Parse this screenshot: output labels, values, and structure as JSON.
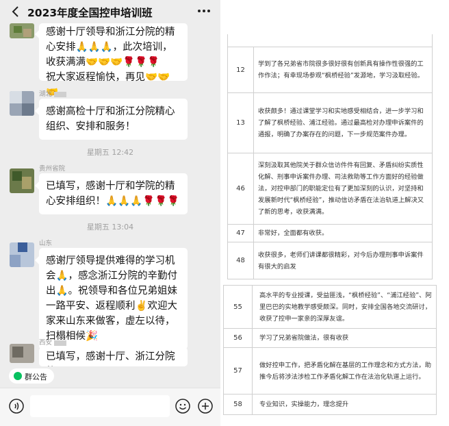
{
  "chat": {
    "title": "2023年度全国控申培训班",
    "input_placeholder": "",
    "notice_label": "群公告",
    "messages": [
      {
        "sender": "",
        "text": "感谢十厅领导和浙江分院的精心安排🙏🙏🙏，此次培训，收获满满🤝🤝🤝🌹🌹🌹\n祝大家返程愉快，再见🤝🤝🤝"
      },
      {
        "sender": "湖北",
        "text": "感谢高检十厅和浙江分院精心组织、安排和服务！"
      },
      {
        "sender": "贵州省院",
        "text": "已填写，感谢十厅和学院的精心安排组织！🙏🙏🙏🌹🌹🌹"
      },
      {
        "sender": "山东",
        "text": "感谢厅领导提供难得的学习机会🙏，感念浙江分院的辛勤付出🙏。祝领导和各位兄弟姐妹一路平安、返程顺利✌️欢迎大家来山东来做客，虚左以待，扫榻相候🎉"
      },
      {
        "sender": "西安",
        "text": "已填写，感谢十厅、浙江分院的"
      }
    ],
    "timestamps": [
      "星期五 12:42",
      "星期五 13:04"
    ]
  },
  "feedback_table": {
    "rows": [
      {
        "num": "12",
        "text": "学到了各兄弟省市院很多很好很有创新具有操作性很强的工作作法；有幸现场参观“枫桥经验”发源地，学习汲取经验。"
      },
      {
        "num": "13",
        "text": "收获颇多！通过课堂学习和实地感受相结合，进一步学习和了解了枫桥经验、浦江经验。通过最高检对办理申诉案件的通报，明确了办案存在的问题，下一步规范案件办理。"
      },
      {
        "num": "46",
        "text": "深刻汲取其他院关于群众信访件件有回复、矛盾纠纷实质性化解、刑事申诉案件办理、司法救助等工作方面好的经验做法，对控申部门的职能定位有了更加深刻的认识，对坚持和发展新时代“枫桥经验”，推动信访矛盾在法治轨道上解决又了新的思考，收获满满。"
      },
      {
        "num": "47",
        "text": "非常好，全面都有收获。"
      },
      {
        "num": "48",
        "text": "收获很多，老师们讲课都很精彩，对今后办理刑事申诉案件有很大的启发"
      },
      {
        "num": "55",
        "text": "高水平的专业授课，受益匪浅，“枫桥经验”、“浦江经验”、阿里巴巴的实地教学感受颇深。同时，安排全国各地交流研讨，收获了控申一家亲的深厚友谊。"
      },
      {
        "num": "56",
        "text": "学习了兄弟省院做法，很有收获"
      },
      {
        "num": "57",
        "text": "做好控申工作，把矛盾化解在基层的工作理念和方式方法，助推今后将涉法涉检工作矛盾化解工作在法治化轨道上运行。"
      },
      {
        "num": "58",
        "text": "专业知识，实操能力，理念提升"
      }
    ]
  },
  "colors": {
    "chat_background": "#ededed",
    "bubble": "#ffffff",
    "accent_green": "#07c160",
    "table_border": "#cfcfcf"
  },
  "icons": {
    "back": "chevron-left-icon",
    "more": "more-dots-icon",
    "voice": "voice-icon",
    "emoji": "emoji-icon",
    "plus": "plus-icon",
    "notice": "notice-icon"
  }
}
